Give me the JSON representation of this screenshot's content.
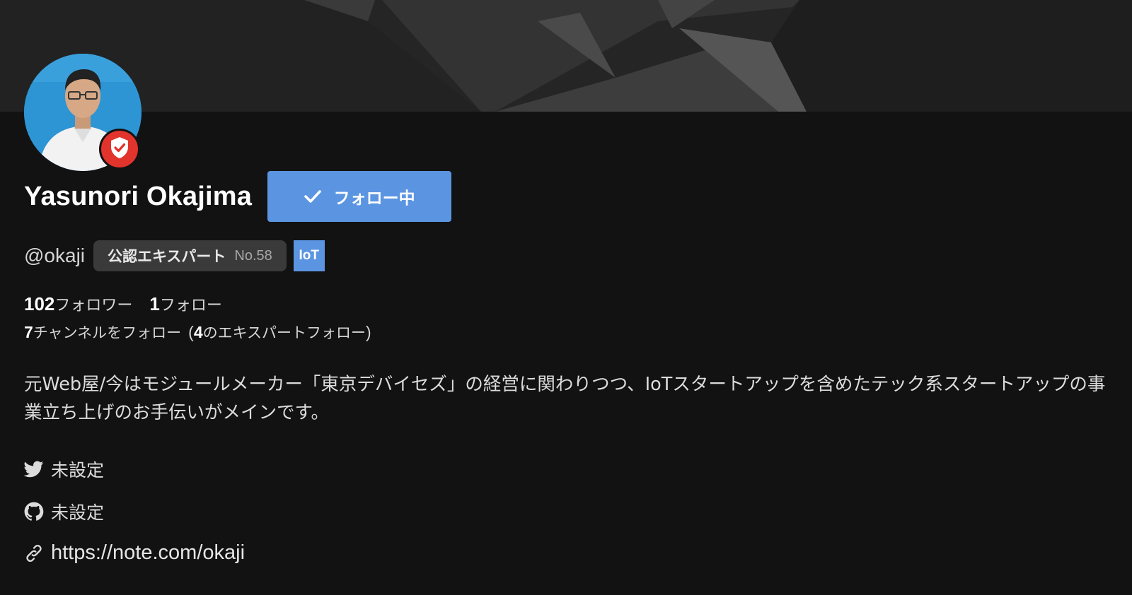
{
  "profile": {
    "name": "Yasunori Okajima",
    "handle": "@okaji",
    "follow_button_label": "フォロー中",
    "expert_badge": {
      "label": "公認エキスパート",
      "number": "No.58"
    },
    "tag": "IoT",
    "stats": {
      "followers_count": "102",
      "followers_label": "フォロワー",
      "following_count": "1",
      "following_label": "フォロー",
      "channels_count": "7",
      "channels_label": "チャンネルをフォロー",
      "paren_open": "(",
      "experts_count": "4",
      "experts_label": "のエキスパートフォロー",
      "paren_close": ")"
    },
    "bio": "元Web屋/今はモジュールメーカー「東京デバイセズ」の経営に関わりつつ、IoTスタートアップを含めたテック系スタートアップの事業立ち上げのお手伝いがメインです。",
    "links": {
      "twitter": {
        "icon": "twitter-icon",
        "value": "未設定"
      },
      "github": {
        "icon": "github-icon",
        "value": "未設定"
      },
      "website": {
        "icon": "link-icon",
        "value": "https://note.com/okaji"
      }
    }
  },
  "colors": {
    "background": "#121212",
    "accent_blue": "#5b95e2",
    "verified_red": "#e2332c",
    "badge_gray": "#3a3a3a"
  }
}
